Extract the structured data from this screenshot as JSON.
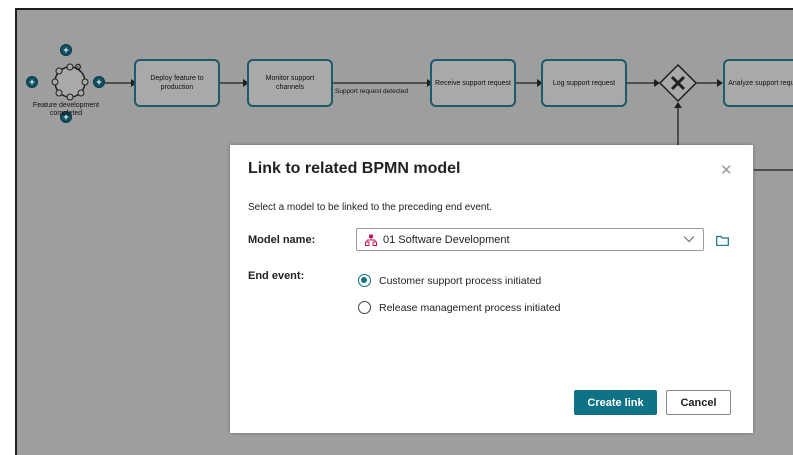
{
  "diagram": {
    "start_event_label": "Feature development completed",
    "tasks": [
      {
        "label": "Deploy feature to production"
      },
      {
        "label": "Monitor support channels"
      },
      {
        "label": "Receive support request"
      },
      {
        "label": "Log support request"
      },
      {
        "label": "Analyze support request"
      }
    ],
    "flow_label": "Support request detected",
    "gateway_icon": "exclusive-gateway-x-icon",
    "plus_icon": "plus-icon",
    "gear_icon": "gear-icon"
  },
  "dialog": {
    "title": "Link to related BPMN model",
    "close_icon": "close-icon",
    "description": "Select a model to be linked to the preceding end event.",
    "model_label": "Model name:",
    "model_value": "01 Software Development",
    "model_icon": "bpmn-model-icon",
    "chevron_icon": "chevron-down-icon",
    "folder_icon": "folder-icon",
    "end_event_label": "End event:",
    "end_event_options": [
      {
        "label": "Customer support process initiated",
        "selected": true
      },
      {
        "label": "Release management process initiated",
        "selected": false
      }
    ],
    "create_button": "Create link",
    "cancel_button": "Cancel"
  },
  "colors": {
    "accent": "#0f7285",
    "canvas_overlay": "#9e9e9e",
    "task_border": "#1d5a6d"
  }
}
